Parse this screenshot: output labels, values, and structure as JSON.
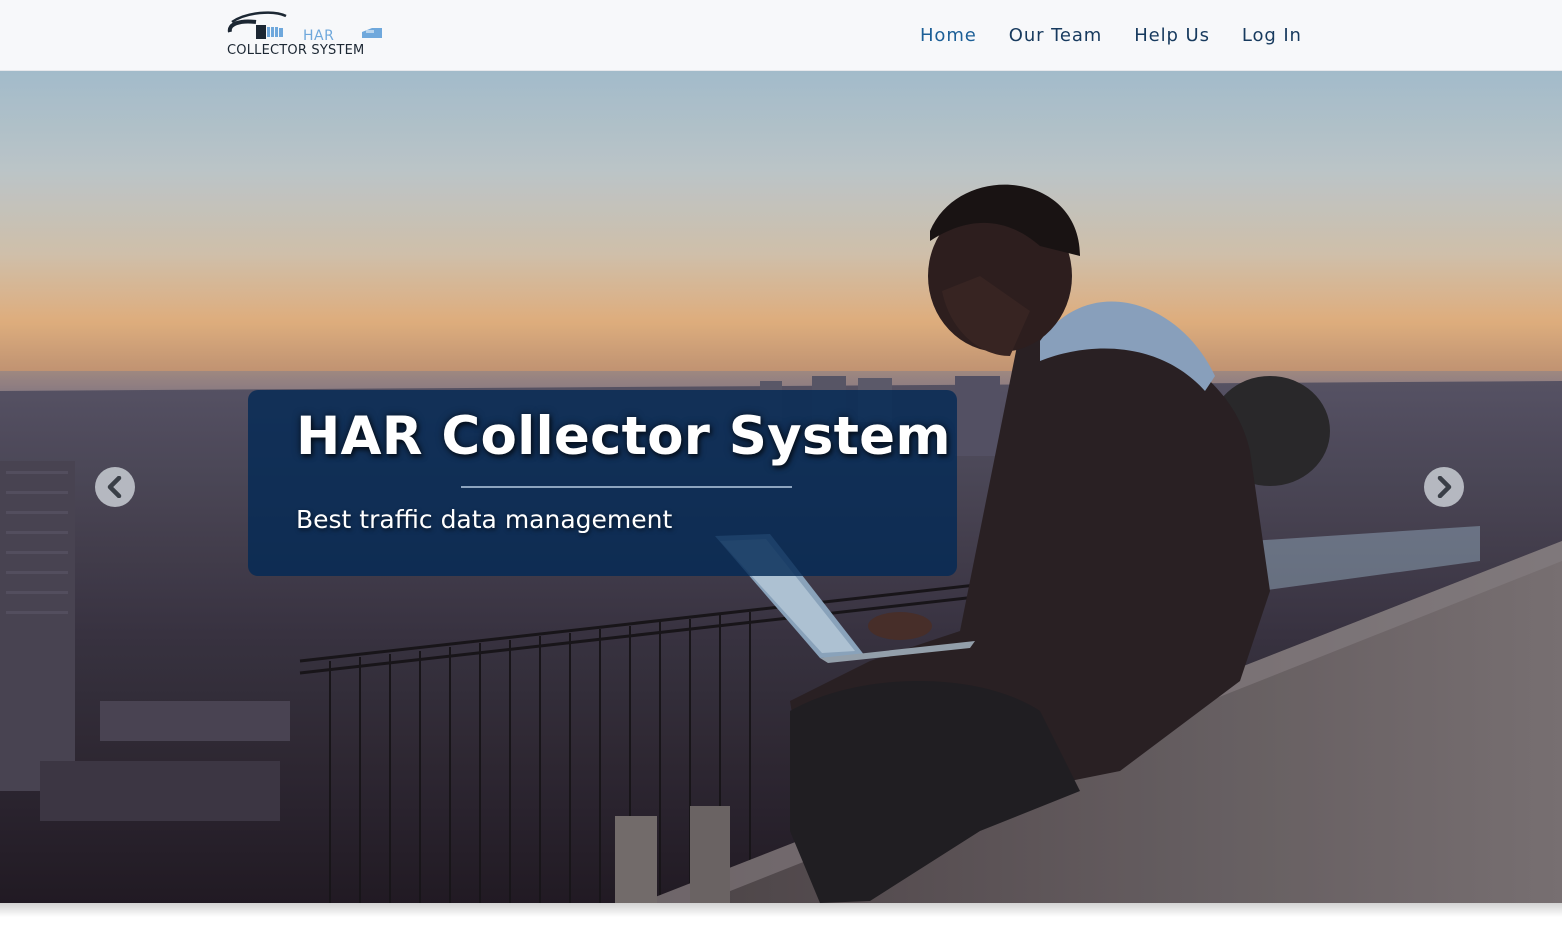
{
  "navbar": {
    "logo": {
      "har_text": "HAR",
      "name_text": "COLLECTOR SYSTEM",
      "icon": "network-cable-logo-icon"
    },
    "links": [
      {
        "label": "Home",
        "active": true
      },
      {
        "label": "Our Team",
        "active": false
      },
      {
        "label": "Help Us",
        "active": false
      },
      {
        "label": "Log In",
        "active": false
      }
    ]
  },
  "hero": {
    "title": "HAR Collector System",
    "subtitle": "Best traffic data management",
    "prev_icon": "chevron-left-icon",
    "next_icon": "chevron-right-icon",
    "background": "photo of person using laptop on ledge overlooking city at dusk"
  },
  "colors": {
    "nav_link": "#173a5e",
    "caption_bg": "#042a56",
    "logo_accent": "#6fa8dc"
  }
}
